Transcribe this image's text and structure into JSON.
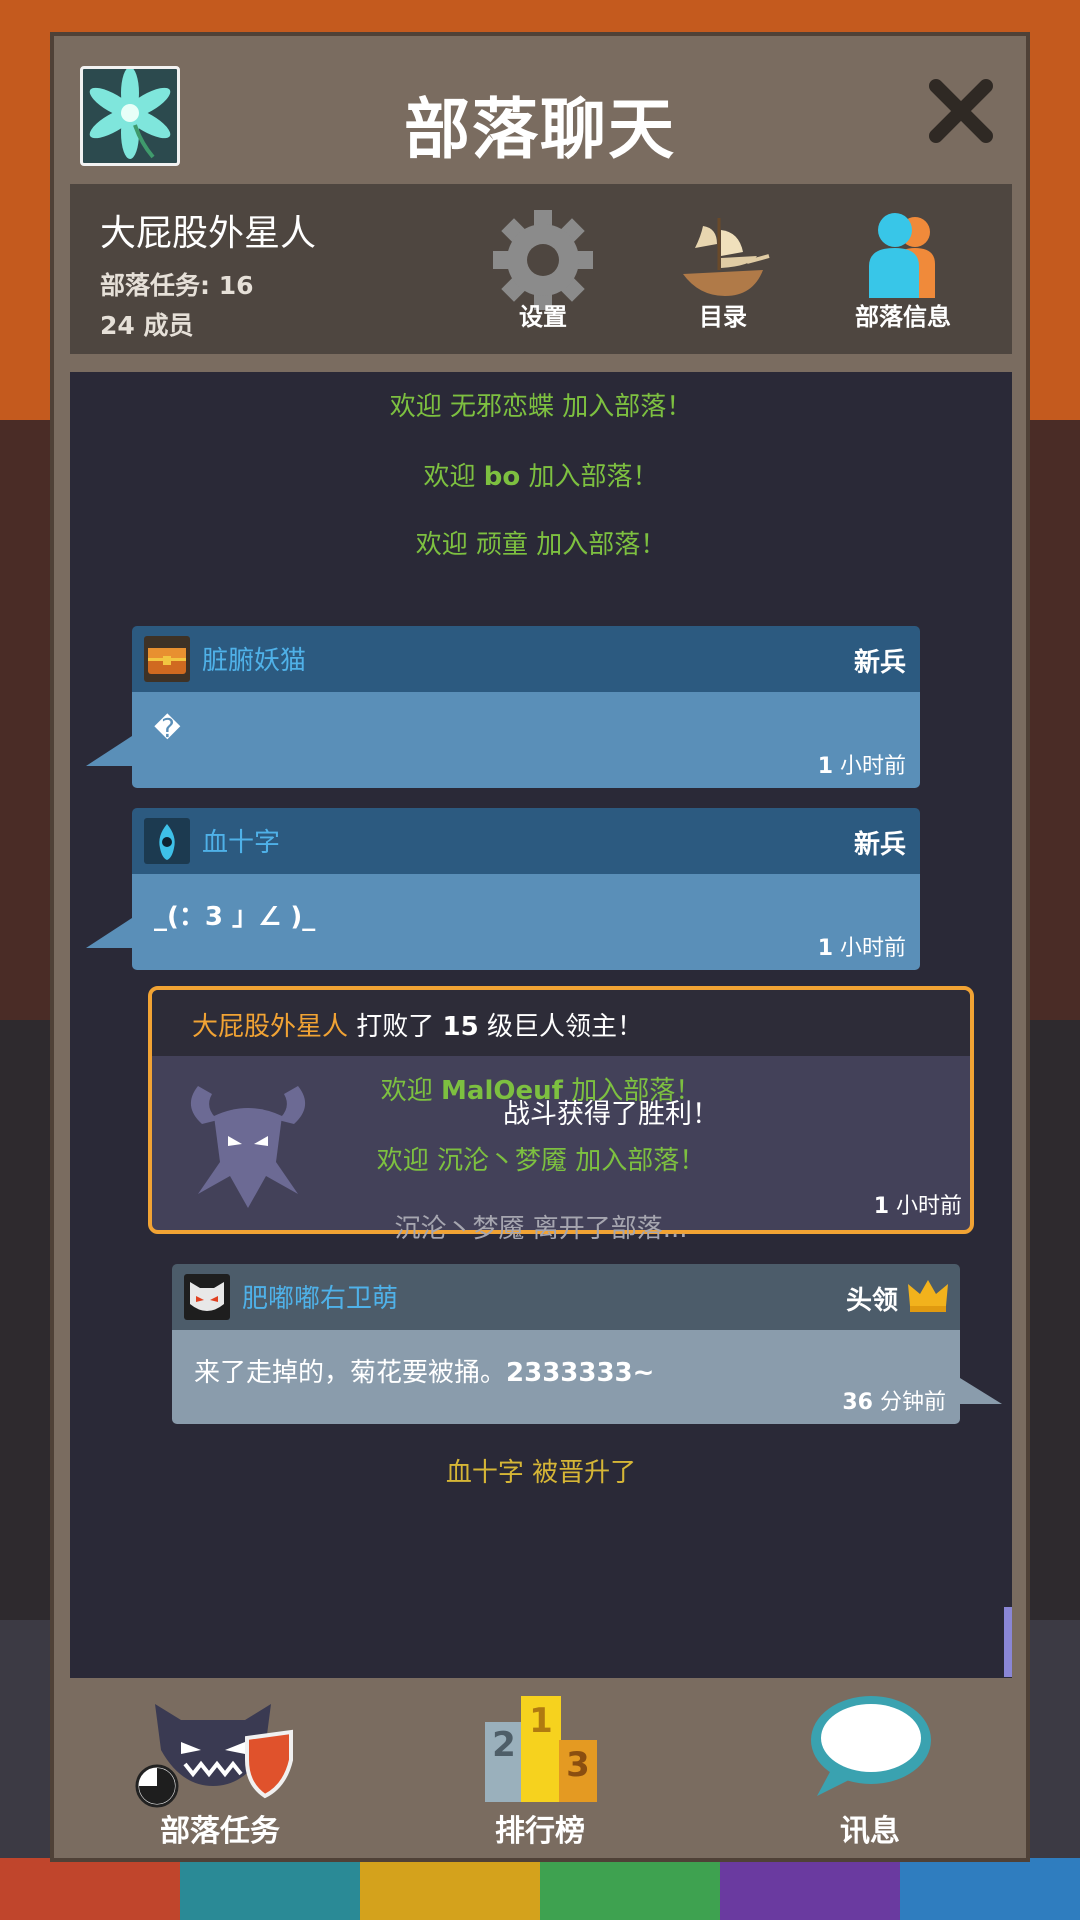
{
  "header": {
    "title": "部落聊天",
    "close_icon": "close-icon",
    "avatar_icon": "flower-icon"
  },
  "tribe": {
    "name": "大屁股外星人",
    "quests": "部落任务: 16",
    "members": "24 成员"
  },
  "info_buttons": [
    {
      "label": "设置",
      "icon": "gear-icon"
    },
    {
      "label": "目录",
      "icon": "ship-icon"
    },
    {
      "label": "部落信息",
      "icon": "people-icon"
    }
  ],
  "chat": {
    "sys1": {
      "pre": "欢迎 ",
      "name": "无邪恋蝶",
      "post": " 加入部落！"
    },
    "sys2": {
      "pre": "欢迎 ",
      "name": "bo",
      "post": " 加入部落！"
    },
    "sys3": {
      "pre": "欢迎 ",
      "name": "顽童",
      "post": " 加入部落！"
    },
    "msg1": {
      "user": "脏腑妖猫",
      "rank": "新兵",
      "text": "�",
      "time_num": "1",
      "time_unit": " 小时前",
      "icon": "treasure-chest-icon"
    },
    "msg2": {
      "user": "血十字",
      "rank": "新兵",
      "text": "_(：3 」∠ )_",
      "time_num": "1",
      "time_unit": " 小时前",
      "icon": "flame-spirit-icon"
    },
    "event": {
      "player": "大屁股外星人",
      "mid": " 打败了 ",
      "level": "15",
      "post": " 级巨人领主！",
      "result": "战斗获得了胜利！",
      "time_num": "1",
      "time_unit": " 小时前",
      "icon": "demon-boss-icon"
    },
    "sys4": {
      "pre": "欢迎 ",
      "name": "MalOeuf",
      "post": " 加入部落！"
    },
    "sys5": {
      "pre": "欢迎 ",
      "name": "沉沦丶梦魇",
      "post": " 加入部落！"
    },
    "sys6": {
      "text": "沉沦丶梦魇 离开了部落..."
    },
    "msg3": {
      "user": "肥嘟嘟右卫萌",
      "rank": "头领",
      "text_pre": "来了走掉的，菊花要被捅。",
      "text_bold": "2333333~",
      "time_num": "36",
      "time_unit": " 分钟前",
      "icon": "cat-mask-icon",
      "rank_icon": "crown-icon"
    },
    "sys7": {
      "text": "血十字 被晋升了"
    }
  },
  "tabs": [
    {
      "label": "部落任务",
      "icon": "demon-shield-icon"
    },
    {
      "label": "排行榜",
      "icon": "podium-icon",
      "places": [
        "2",
        "1",
        "3"
      ]
    },
    {
      "label": "讯息",
      "icon": "speech-bubble-icon"
    }
  ],
  "colors": {
    "panel": "#7a6c60",
    "chat_bg": "#2a2937",
    "accent_orange": "#f1a334",
    "welcome_green": "#7dc040",
    "user_blue": "#4fb1e8"
  }
}
